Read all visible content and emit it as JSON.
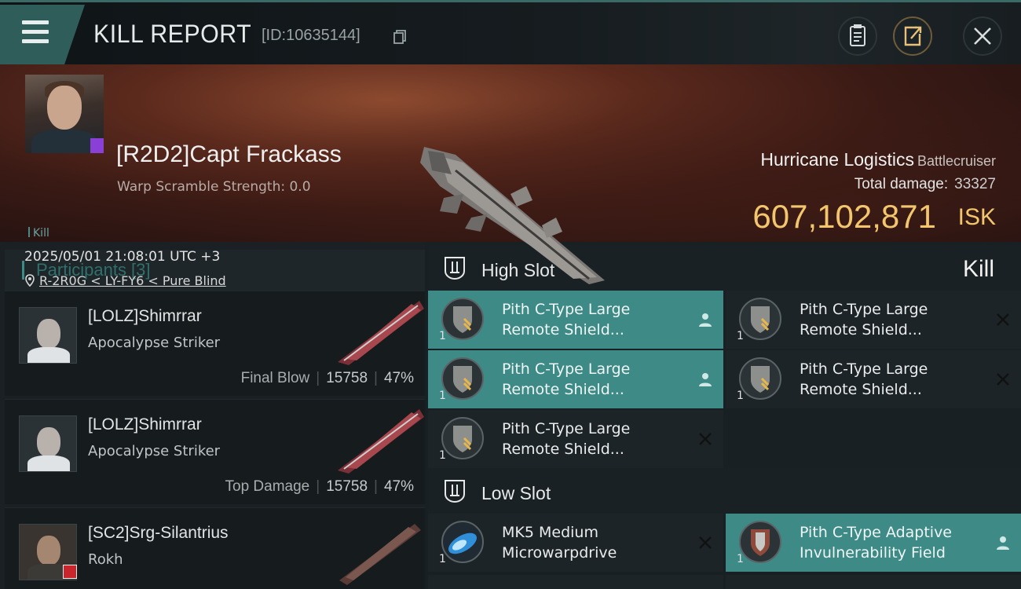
{
  "topbar": {
    "title": "KILL REPORT",
    "report_id": "[ID:10635144]",
    "icons": [
      "menu-icon",
      "copy-icon",
      "clipboard-icon",
      "share-icon",
      "close-icon"
    ],
    "accent_color": "#2e5d5a"
  },
  "victim": {
    "name": "[R2D2]Capt Frackass",
    "warp_scramble": "Warp Scramble Strength: 0.0",
    "tag": "Kill",
    "datetime": "2025/05/01 21:08:01 UTC +3",
    "location": "R-2R0G < LY-FY6 < Pure Blind",
    "ship_name": "Hurricane Logistics",
    "ship_class": "Battlecruiser",
    "total_damage_label": "Total damage:",
    "total_damage": "33327",
    "isk_value": "607,102,871",
    "isk_unit": "ISK",
    "result": "Kill"
  },
  "participants": {
    "title": "Participants [3]",
    "rows": [
      {
        "name": "[LOLZ]Shimrrar",
        "ship": "Apocalypse Striker",
        "label": "Final Blow",
        "damage": "15758",
        "percent": "47%"
      },
      {
        "name": "[LOLZ]Shimrrar",
        "ship": "Apocalypse Striker",
        "label": "Top Damage",
        "damage": "15758",
        "percent": "47%"
      },
      {
        "name": "[SC2]Srg-Silantrius",
        "ship": "Rokh",
        "label": "",
        "damage": "",
        "percent": ""
      }
    ]
  },
  "fitting": {
    "high_slot": {
      "title": "High Slot",
      "modules": [
        {
          "name": "Pith C-Type Large Remote Shield...",
          "qty": "1",
          "state": "dropped"
        },
        {
          "name": "Pith C-Type Large Remote Shield...",
          "qty": "1",
          "state": "destroyed"
        },
        {
          "name": "Pith C-Type Large Remote Shield...",
          "qty": "1",
          "state": "dropped"
        },
        {
          "name": "Pith C-Type Large Remote Shield...",
          "qty": "1",
          "state": "destroyed"
        },
        {
          "name": "Pith C-Type Large Remote Shield...",
          "qty": "1",
          "state": "destroyed"
        }
      ]
    },
    "low_slot": {
      "title": "Low Slot",
      "modules": [
        {
          "name": "MK5 Medium Microwarpdrive",
          "qty": "1",
          "state": "destroyed"
        },
        {
          "name": "Pith C-Type Adaptive Invulnerability Field",
          "qty": "1",
          "state": "dropped"
        }
      ]
    },
    "highlight_color": "#3e8a86",
    "isk_color": "#f3c66e"
  }
}
